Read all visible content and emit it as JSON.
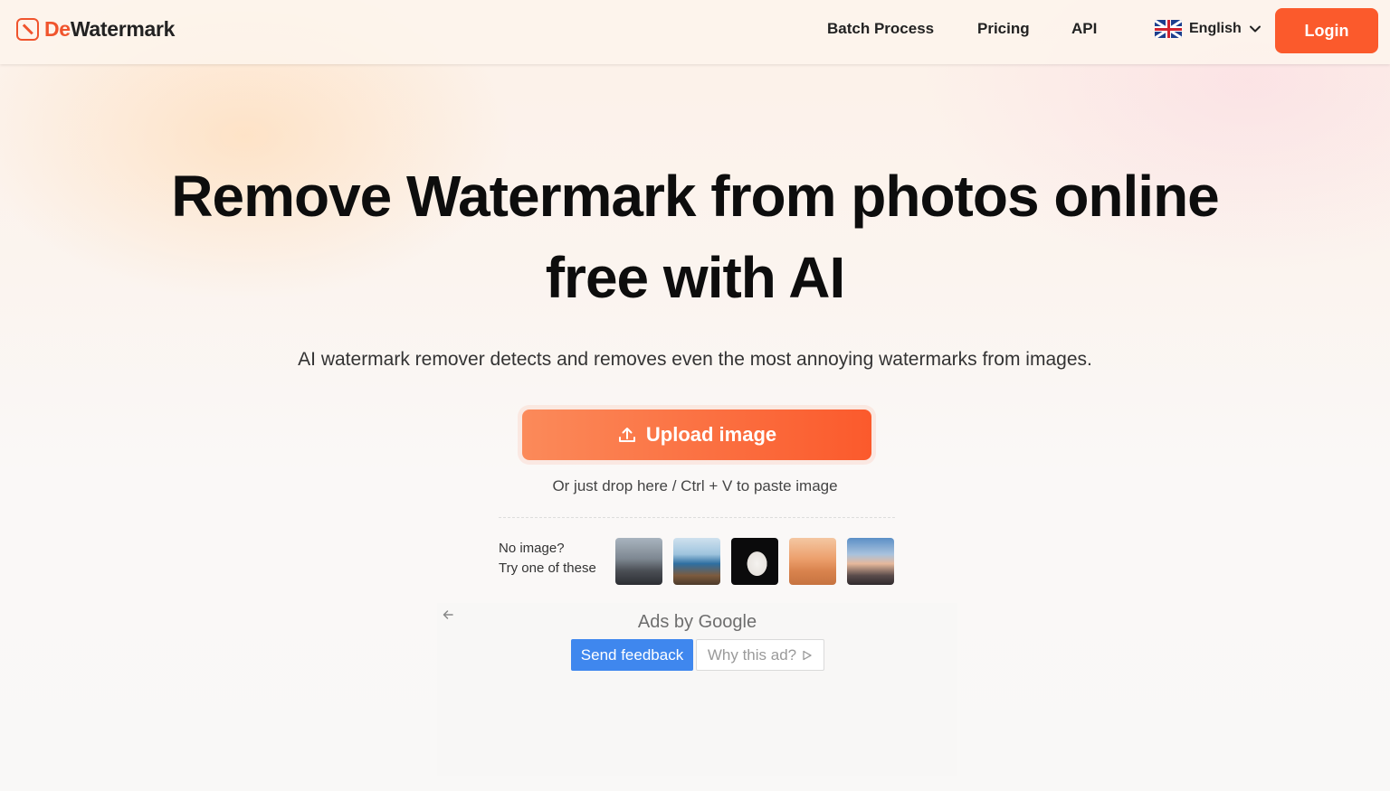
{
  "brand": {
    "prefix": "De",
    "suffix": "Watermark",
    "accent": "#f0542d"
  },
  "nav": {
    "items": [
      "Batch Process",
      "Pricing",
      "API"
    ],
    "language": "English",
    "login_label": "Login",
    "login_color": "#fb5a2c"
  },
  "hero": {
    "title_line1": "Remove Watermark from photos online",
    "title_line2": "free with AI",
    "subtitle": "AI watermark remover detects and removes even the most annoying watermarks from images."
  },
  "upload": {
    "button_label": "Upload image",
    "hint": "Or just drop here / Ctrl + V to paste image"
  },
  "samples": {
    "line1": "No image?",
    "line2": "Try one of these",
    "images": [
      "sample-house",
      "sample-lake",
      "sample-portrait",
      "sample-desert",
      "sample-sunset"
    ]
  },
  "ad": {
    "ads_by_prefix": "Ads by ",
    "ads_by_brand": "Google",
    "send_feedback": "Send feedback",
    "why_this_ad": "Why this ad?"
  }
}
